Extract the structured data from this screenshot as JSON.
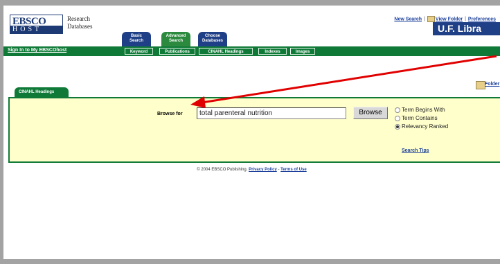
{
  "logo": {
    "top": "EBSCO",
    "bottom": "HOST"
  },
  "db_text": {
    "line1": "Research",
    "line2": "Databases"
  },
  "tabs": [
    {
      "line1": "Basic",
      "line2": "Search"
    },
    {
      "line1": "Advanced",
      "line2": "Search"
    },
    {
      "line1": "Choose",
      "line2": "Databases"
    }
  ],
  "top_links": {
    "new_search": "New Search",
    "view_folder": "View Folder",
    "preferences": "Preferences"
  },
  "library": "U.F. Libra",
  "nav": {
    "sign_in": "Sign In to My EBSCOhost",
    "buttons": [
      "Keyword",
      "Publications",
      "CINAHL Headings",
      "Indexes",
      "Images"
    ]
  },
  "panel": {
    "tab_label": "CINAHL Headings",
    "folder_link": "Folder",
    "browse_label": "Browse for",
    "browse_value": "total parenteral nutrition",
    "browse_button": "Browse",
    "options": [
      {
        "label": "Term Begins With",
        "checked": false
      },
      {
        "label": "Term Contains",
        "checked": false
      },
      {
        "label": "Relevancy Ranked",
        "checked": true
      }
    ],
    "search_tips": "Search Tips"
  },
  "footer": {
    "copyright": "© 2004 EBSCO Publishing.",
    "privacy": "Privacy Policy",
    "dash": " - ",
    "terms": "Terms of Use"
  },
  "colors": {
    "green": "#0f7a37",
    "navy": "#1f3f86",
    "panel_bg": "#ffffcc",
    "arrow": "#e10000"
  }
}
